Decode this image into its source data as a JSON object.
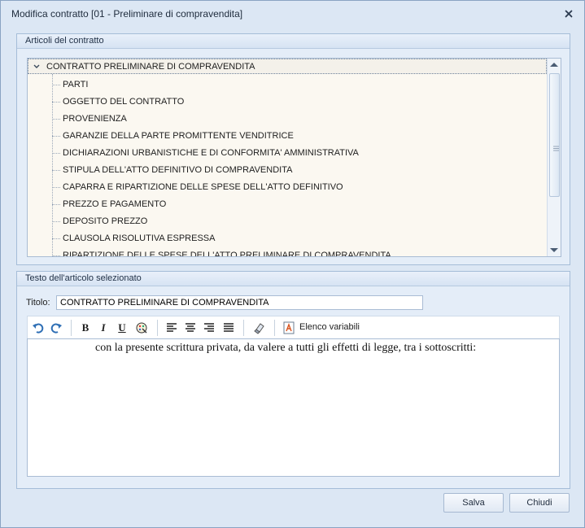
{
  "window": {
    "title": "Modifica contratto [01 - Preliminare di compravendita]"
  },
  "articles_group": {
    "title": "Articoli del contratto",
    "root": "CONTRATTO PRELIMINARE DI COMPRAVENDITA",
    "items": [
      "PARTI",
      "OGGETTO DEL CONTRATTO",
      "PROVENIENZA",
      "GARANZIE DELLA PARTE PROMITTENTE VENDITRICE",
      "DICHIARAZIONI URBANISTICHE E DI CONFORMITA' AMMINISTRATIVA",
      "STIPULA DELL'ATTO DEFINITIVO DI COMPRAVENDITA",
      "CAPARRA E RIPARTIZIONE DELLE SPESE DELL'ATTO DEFINITIVO",
      "PREZZO E PAGAMENTO",
      "DEPOSITO PREZZO",
      "CLAUSOLA RISOLUTIVA ESPRESSA",
      "RIPARTIZIONE DELLE SPESE DELL'ATTO PRELIMINARE DI COMPRAVENDITA"
    ]
  },
  "text_group": {
    "title": "Testo dell'articolo selezionato",
    "titolo_label": "Titolo:",
    "titolo_value": "CONTRATTO PRELIMINARE DI COMPRAVENDITA",
    "toolbar": {
      "elenco_variabili": "Elenco variabili",
      "bold": "B",
      "italic": "I",
      "underline": "U"
    },
    "body": "con la presente scrittura privata, da valere a tutti gli effetti di legge, tra i sottoscritti:"
  },
  "buttons": {
    "save": "Salva",
    "close": "Chiudi"
  },
  "colors": {
    "window_bg": "#dce7f4",
    "tree_bg": "#fbf8f1",
    "accent": "#2f6fb5"
  }
}
